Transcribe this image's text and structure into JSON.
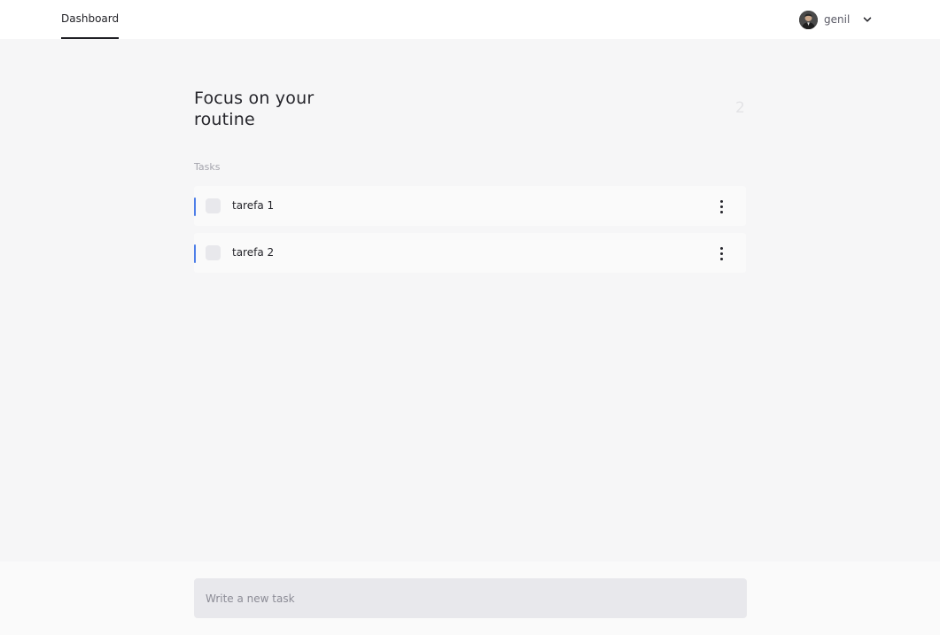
{
  "nav": {
    "tab_label": "Dashboard"
  },
  "user": {
    "name": "genil",
    "avatar_icon": "user-avatar-photo",
    "menu_icon": "chevron-down-icon"
  },
  "main": {
    "headline": "Focus on your routine",
    "task_count": "2",
    "section_label": "Tasks",
    "tasks": [
      {
        "label": "tarefa 1",
        "done": false
      },
      {
        "label": "tarefa 2",
        "done": false
      }
    ],
    "task_menu_icon": "more-vertical-icon"
  },
  "footer": {
    "input_placeholder": "Write a new task",
    "input_value": ""
  },
  "colors": {
    "accent": "#4e7ee8",
    "background": "#f6f6f7",
    "input_background": "#e8e8ec"
  }
}
